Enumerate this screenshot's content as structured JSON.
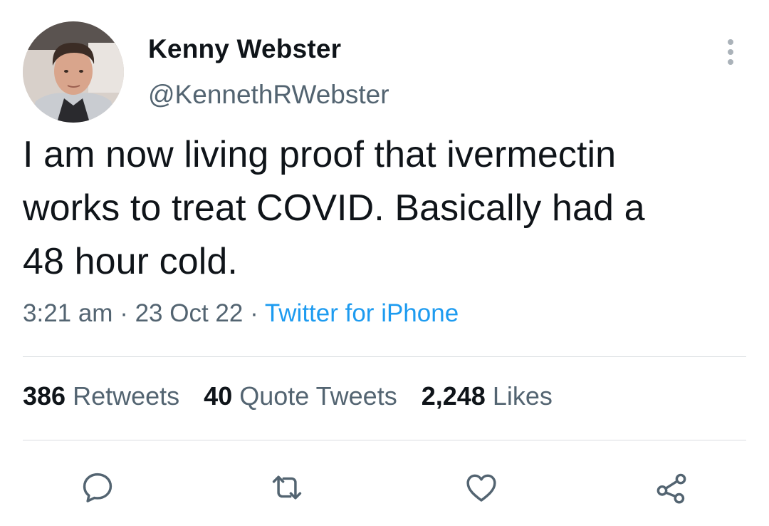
{
  "user": {
    "display_name": "Kenny Webster",
    "handle": "@KennethRWebster"
  },
  "tweet": {
    "text": "I am now living proof that ivermectin\nworks to treat COVID. Basically had a\n48 hour cold.",
    "time": "3:21 am",
    "separator": " · ",
    "date": "23 Oct 22",
    "source": "Twitter for iPhone"
  },
  "stats": {
    "retweets_count": "386",
    "retweets_label": "Retweets",
    "quotes_count": "40",
    "quotes_label": "Quote Tweets",
    "likes_count": "2,248",
    "likes_label": "Likes"
  },
  "icons": {
    "reply": "reply-icon",
    "retweet": "retweet-icon",
    "like": "heart-icon",
    "share": "share-icon",
    "more": "more-vertical-icon"
  },
  "colors": {
    "text_primary": "#0f1419",
    "text_secondary": "#536471",
    "link": "#1d9bf0",
    "divider": "#d9dde1"
  }
}
